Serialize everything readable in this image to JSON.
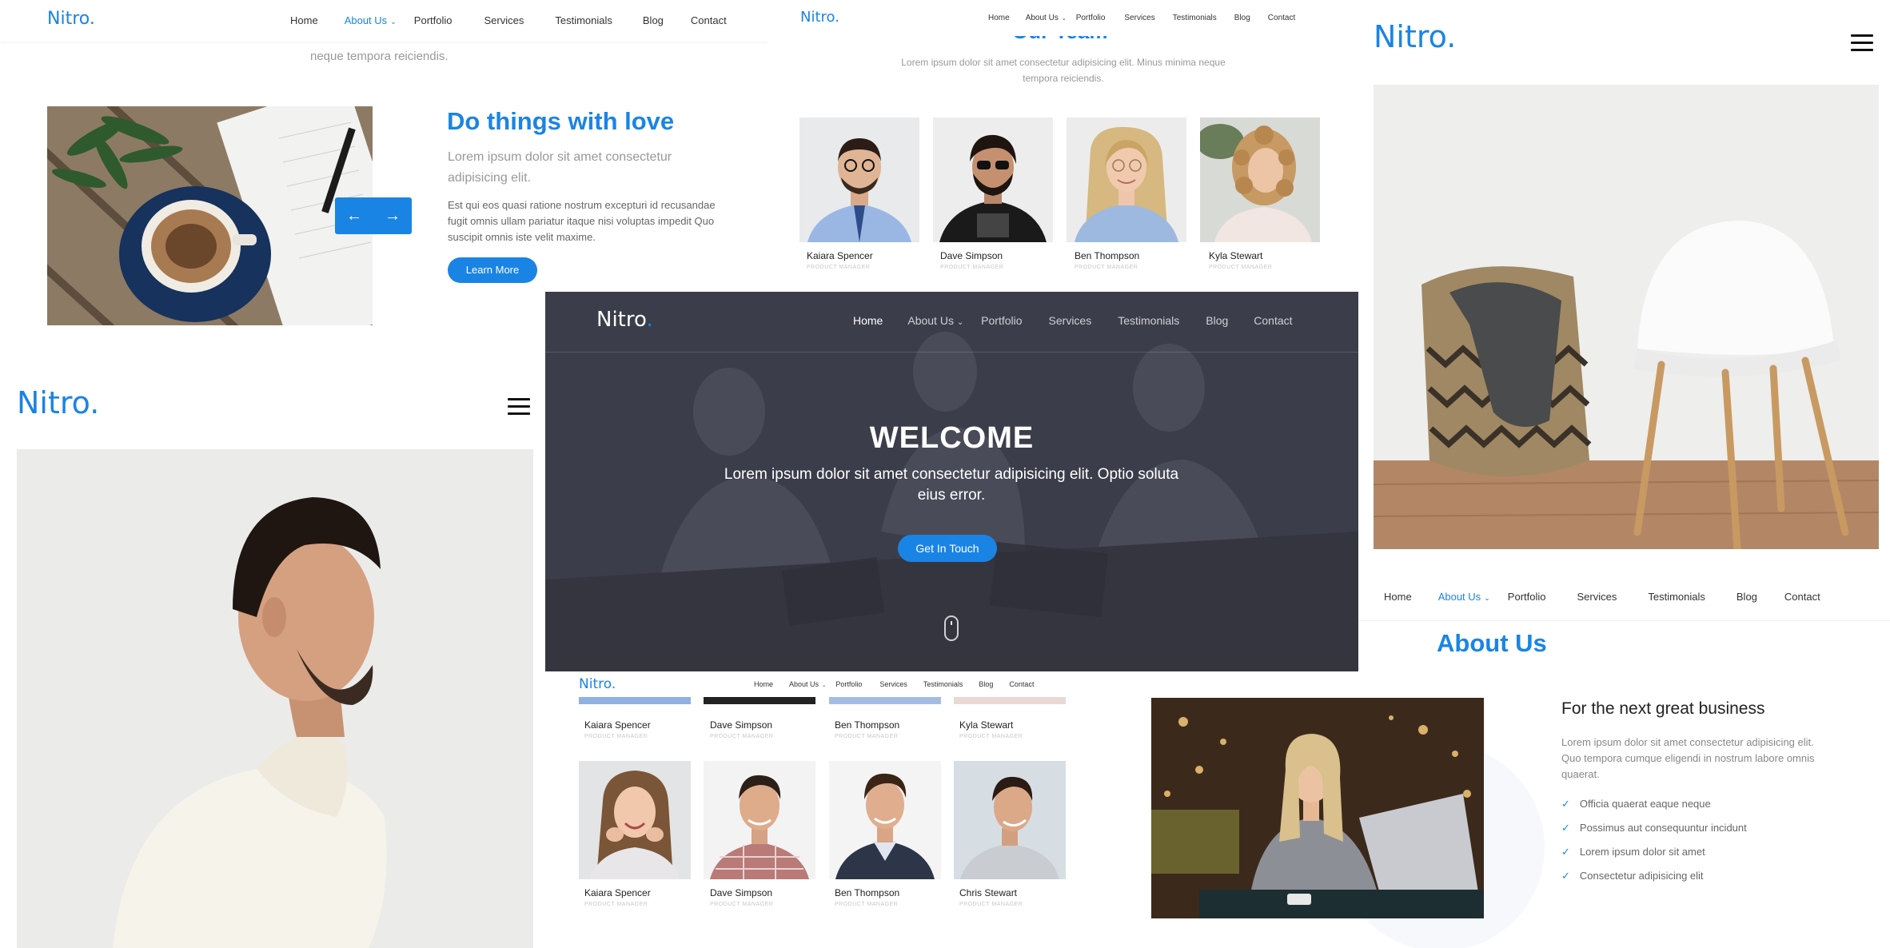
{
  "brand": {
    "logo": "Nitro.",
    "logo_plain": "Nitro",
    "logo_dot": "."
  },
  "nav": {
    "items": [
      "Home",
      "About Us",
      "Portfolio",
      "Services",
      "Testimonials",
      "Blog",
      "Contact"
    ],
    "caret": "⌄"
  },
  "panel_love": {
    "intro_tail": "neque tempora reiciendis.",
    "title": "Do things with love",
    "lead": "Lorem ipsum dolor sit amet consectetur adipisicing elit.",
    "body": "Est qui eos quasi ratione nostrum excepturi id recusandae fugit omnis ullam pariatur itaque nisi voluptas impedit Quo suscipit omnis iste velit maxime.",
    "button": "Learn More",
    "prev_arrow": "←",
    "next_arrow": "→"
  },
  "panel_team_top": {
    "title": "Our Team",
    "subtitle": "Lorem ipsum dolor sit amet consectetur adipisicing elit. Minus minima neque tempora reiciendis.",
    "members": [
      {
        "name": "Kaiara Spencer",
        "role": "PRODUCT MANAGER"
      },
      {
        "name": "Dave Simpson",
        "role": "PRODUCT MANAGER"
      },
      {
        "name": "Ben Thompson",
        "role": "PRODUCT MANAGER"
      },
      {
        "name": "Kyla Stewart",
        "role": "PRODUCT MANAGER"
      }
    ]
  },
  "panel_hero": {
    "title": "WELCOME",
    "subtitle": "Lorem ipsum dolor sit amet consectetur adipisicing elit. Optio soluta eius error.",
    "button": "Get In Touch"
  },
  "panel_team_grid": {
    "row1": [
      {
        "name": "Kaiara Spencer",
        "role": "PRODUCT MANAGER"
      },
      {
        "name": "Dave Simpson",
        "role": "PRODUCT MANAGER"
      },
      {
        "name": "Ben Thompson",
        "role": "PRODUCT MANAGER"
      },
      {
        "name": "Kyla Stewart",
        "role": "PRODUCT MANAGER"
      }
    ],
    "row2": [
      {
        "name": "Kaiara Spencer",
        "role": "PRODUCT MANAGER"
      },
      {
        "name": "Dave Simpson",
        "role": "PRODUCT MANAGER"
      },
      {
        "name": "Ben Thompson",
        "role": "PRODUCT MANAGER"
      },
      {
        "name": "Chris Stewart",
        "role": "PRODUCT MANAGER"
      }
    ]
  },
  "panel_about": {
    "title": "About Us",
    "heading": "For the next great business",
    "body": "Lorem ipsum dolor sit amet consectetur adipisicing elit. Quo tempora cumque eligendi in nostrum labore omnis quaerat.",
    "checklist": [
      "Officia quaerat eaque neque",
      "Possimus aut consequuntur incidunt",
      "Lorem ipsum dolor sit amet",
      "Consectetur adipisicing elit"
    ],
    "tick": "✓"
  },
  "colors": {
    "accent": "#1a84e5",
    "hero_overlay": "#3a3b48",
    "text": "#333333",
    "muted": "#999999"
  }
}
